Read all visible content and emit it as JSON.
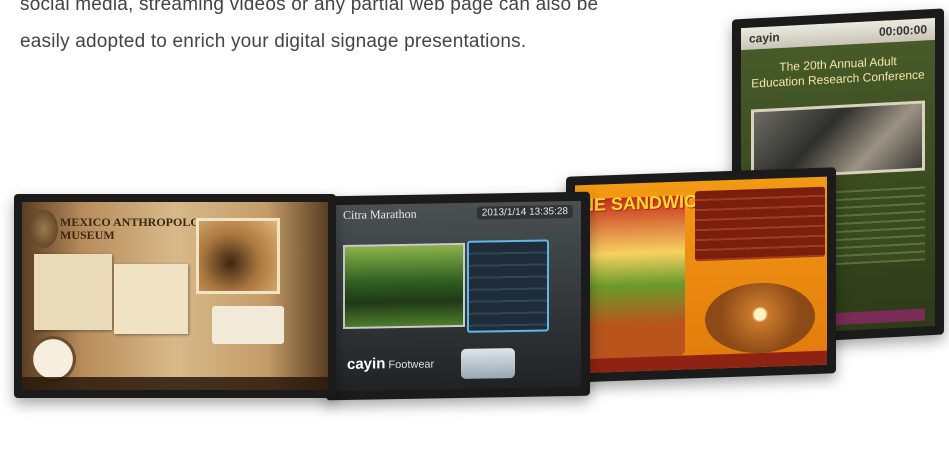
{
  "intro": {
    "line1": "social media, streaming videos or any partial web page can also be",
    "line2": "easily adopted to enrich your digital signage presentations."
  },
  "screens": {
    "museum": {
      "title_line1": "MEXICO ANTHROPOLOGY",
      "title_line2": "MUSEUM"
    },
    "marathon": {
      "title": "Citra Marathon",
      "datetime": "2013/1/14  13:35:28",
      "brand": "cayin",
      "brand_sub": "Footwear"
    },
    "food": {
      "headline": "NE SANDWICH"
    },
    "conference": {
      "brand": "cayin",
      "time": "00:00:00",
      "title_line1": "The 20th Annual Adult",
      "title_line2": "Education Research Conference"
    }
  }
}
